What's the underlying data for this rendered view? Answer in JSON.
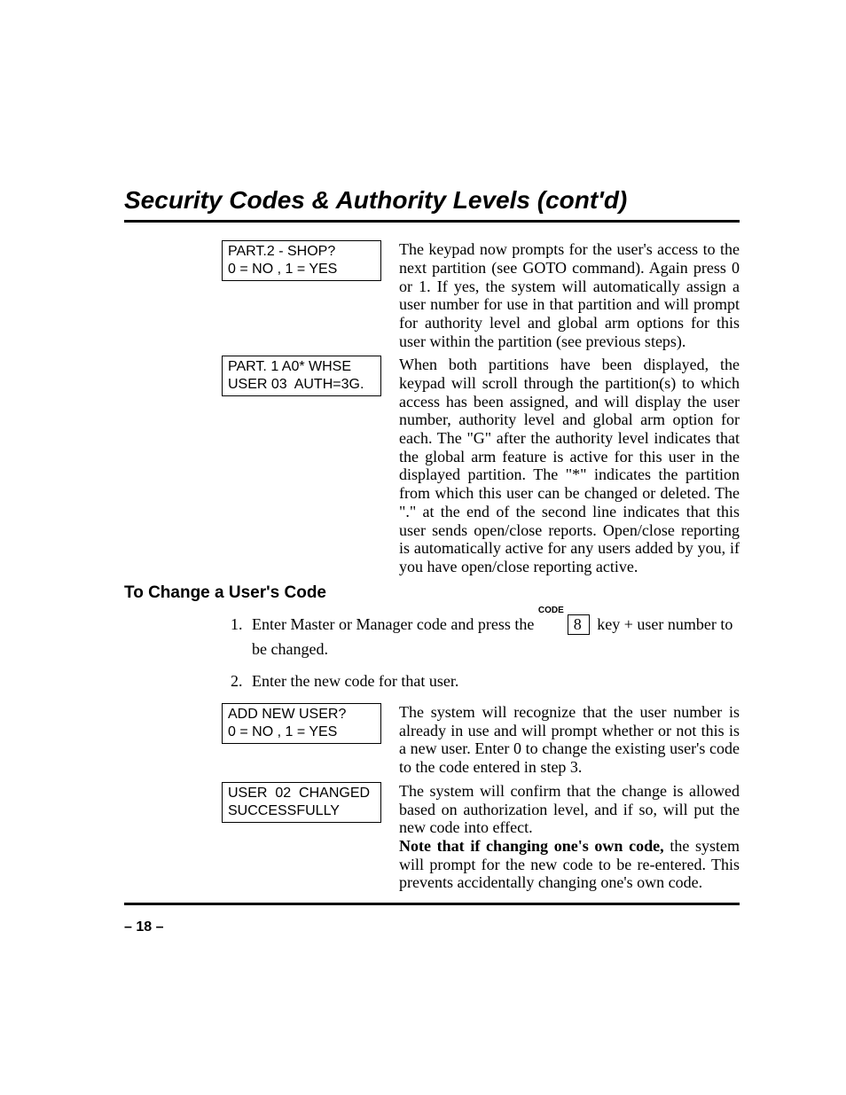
{
  "title": "Security Codes & Authority Levels (cont'd)",
  "block1": {
    "lcd_line1": "PART.2 - SHOP?",
    "lcd_line2": "0 = NO , 1 = YES",
    "para": "The keypad now prompts for the user's access to the next partition (see GOTO command). Again press 0 or 1.  If yes, the system will automatically assign a user number for use in that partition and will prompt for authority level and global arm options for this user within the partition (see previous steps)."
  },
  "block2": {
    "lcd_line1": "PART. 1 A0* WHSE",
    "lcd_line2": "USER 03  AUTH=3G.",
    "para": "When both partitions have been displayed, the keypad will scroll through the partition(s) to which access has been assigned, and will display the user number, authority level and global arm option for each. The \"G\" after the authority level indicates that the global arm feature is active for this user in the displayed partition. The \"*\" indicates the partition from which this user can be changed or deleted. The \".\" at the end of the second line indicates that this user sends open/close reports. Open/close reporting is automatically active for any users added by you, if you have open/close reporting active."
  },
  "subhead": "To Change a User's Code",
  "steps": {
    "s1_pre": "Enter Master or Manager code and press the ",
    "key_label": "CODE",
    "key_digit": "8",
    "s1_post": " key + user number to be changed.",
    "s2": "Enter the new code for that user."
  },
  "block3": {
    "lcd_line1": "ADD NEW USER?",
    "lcd_line2": "0 = NO , 1 = YES",
    "para": "The system will recognize that the user number is already in use and will prompt whether or not this is a new user.  Enter 0 to change the existing user's code to the code entered in step 3."
  },
  "block4": {
    "lcd_line1": "USER  02  CHANGED",
    "lcd_line2": "SUCCESSFULLY",
    "para_plain": "The system will confirm that the change is allowed based on authorization level, and if so, will put the new code into effect.",
    "note_strong": "Note that if changing one's own code, ",
    "note_rest": "the system will prompt for the new code to be re-entered. This prevents accidentally changing one's own code."
  },
  "pagenum": "– 18 –"
}
